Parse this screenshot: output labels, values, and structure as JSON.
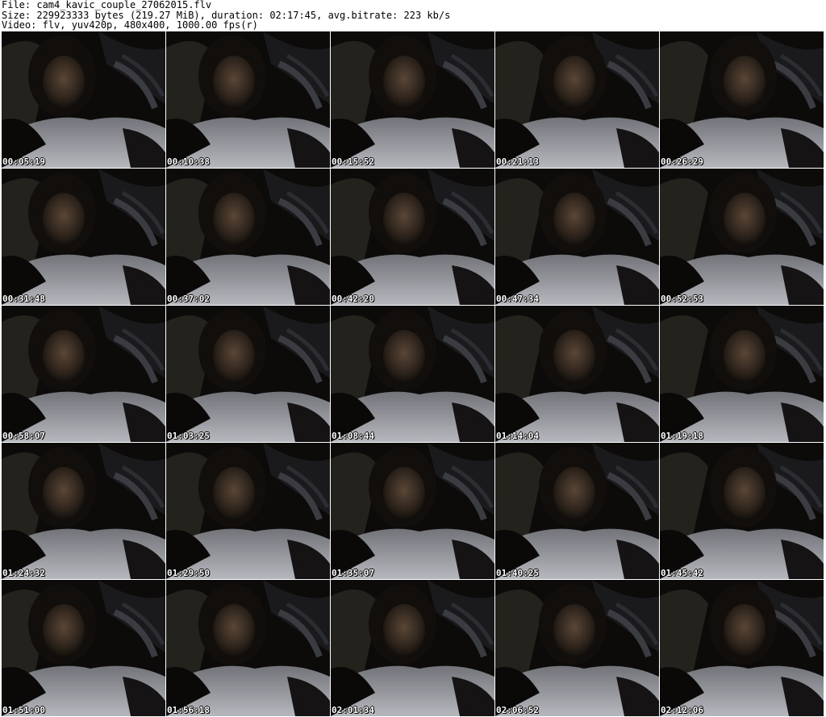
{
  "header": {
    "file_line": "File: cam4_kavic_couple_27062015.flv",
    "size_line": "Size: 229923333 bytes (219.27 MiB), duration: 02:17:45, avg.bitrate: 223 kb/s",
    "video_line": "Video: flv, yuv420p, 480x400, 1000.00 fps(r)"
  },
  "thumbnails": [
    {
      "timestamp": "00:05:19"
    },
    {
      "timestamp": "00:10:38"
    },
    {
      "timestamp": "00:15:52"
    },
    {
      "timestamp": "00:21:13"
    },
    {
      "timestamp": "00:26:29"
    },
    {
      "timestamp": "00:31:48"
    },
    {
      "timestamp": "00:37:02"
    },
    {
      "timestamp": "00:42:20"
    },
    {
      "timestamp": "00:47:34"
    },
    {
      "timestamp": "00:52:53"
    },
    {
      "timestamp": "00:58:07"
    },
    {
      "timestamp": "01:03:25"
    },
    {
      "timestamp": "01:08:44"
    },
    {
      "timestamp": "01:14:04"
    },
    {
      "timestamp": "01:19:18"
    },
    {
      "timestamp": "01:24:32"
    },
    {
      "timestamp": "01:29:50"
    },
    {
      "timestamp": "01:35:07"
    },
    {
      "timestamp": "01:40:25"
    },
    {
      "timestamp": "01:45:42"
    },
    {
      "timestamp": "01:51:00"
    },
    {
      "timestamp": "01:56:18"
    },
    {
      "timestamp": "02:01:34"
    },
    {
      "timestamp": "02:06:52"
    },
    {
      "timestamp": "02:12:06"
    }
  ]
}
